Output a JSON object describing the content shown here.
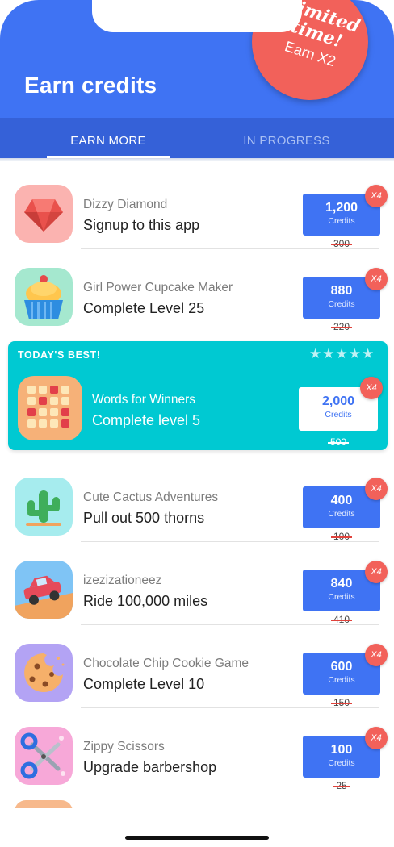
{
  "header": {
    "title": "Earn credits",
    "promo": {
      "line1": "Limited",
      "line2": "time!",
      "line3": "Earn X2"
    }
  },
  "tabs": [
    {
      "label": "EARN MORE",
      "active": true
    },
    {
      "label": "IN PROGRESS",
      "active": false
    }
  ],
  "credits_label": "Credits",
  "offers": [
    {
      "app": "Dizzy Diamond",
      "task": "Signup to this app",
      "credits": "1,200",
      "old_credits": "300",
      "multiplier": "X4",
      "icon": "diamond-icon"
    },
    {
      "app": "Girl Power Cupcake Maker",
      "task": "Complete Level 25",
      "credits": "880",
      "old_credits": "220",
      "multiplier": "X4",
      "icon": "cupcake-icon"
    }
  ],
  "featured": {
    "label": "TODAY'S BEST!",
    "stars": "★★★★★",
    "app": "Words for Winners",
    "task": "Complete level 5",
    "credits": "2,000",
    "old_credits": "500",
    "multiplier": "X4",
    "icon": "word-grid-icon"
  },
  "offers_after": [
    {
      "app": "Cute Cactus Adventures",
      "task": "Pull out 500 thorns",
      "credits": "400",
      "old_credits": "100",
      "multiplier": "X4",
      "icon": "cactus-icon"
    },
    {
      "app": "izezizationeez",
      "task": "Ride 100,000 miles",
      "credits": "840",
      "old_credits": "410",
      "multiplier": "X4",
      "icon": "car-icon"
    },
    {
      "app": "Chocolate Chip Cookie Game",
      "task": "Complete Level 10",
      "credits": "600",
      "old_credits": "150",
      "multiplier": "X4",
      "icon": "cookie-icon"
    },
    {
      "app": "Zippy Scissors",
      "task": "Upgrade barbershop",
      "credits": "100",
      "old_credits": "25",
      "multiplier": "X4",
      "icon": "scissors-icon"
    }
  ],
  "colors": {
    "primary": "#3f73f3",
    "tab_bar": "#3561d8",
    "featured": "#00c9d2",
    "badge": "#f2615a"
  }
}
